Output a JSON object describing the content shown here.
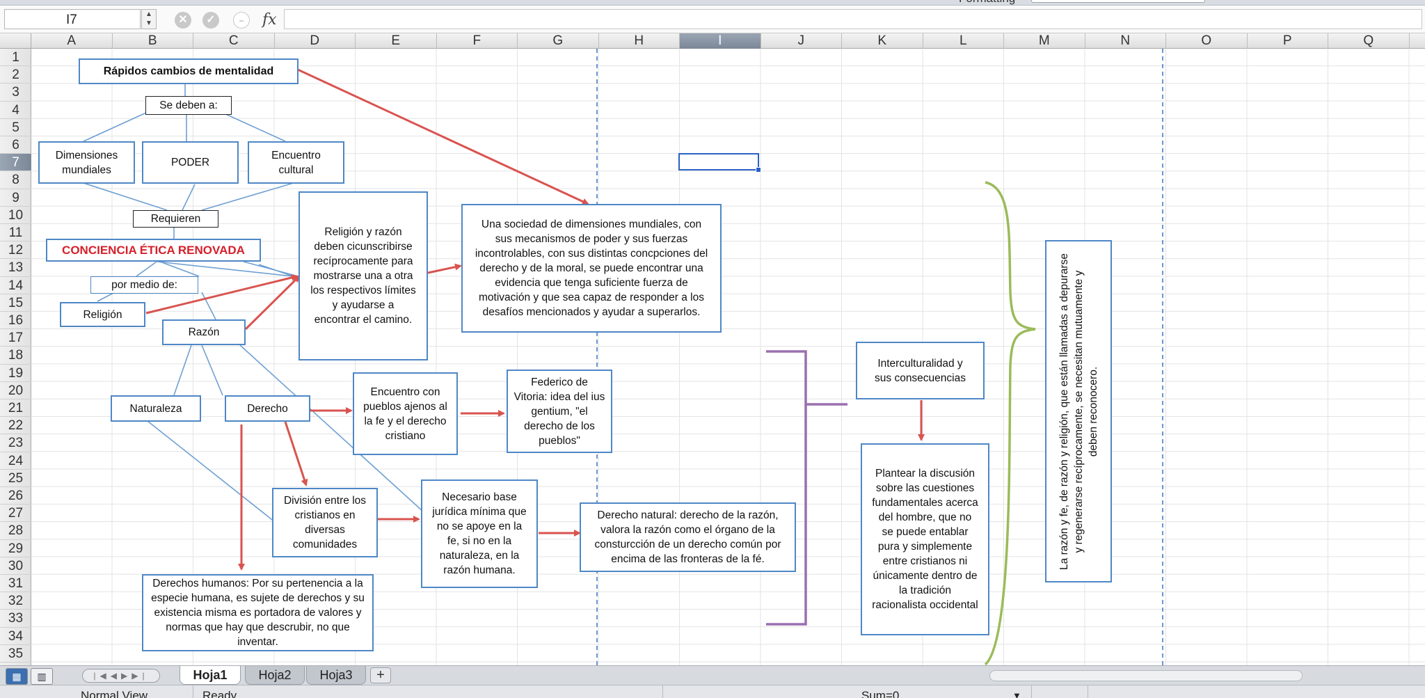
{
  "toolbar": {
    "formatting_label": "Formatting"
  },
  "formula_bar": {
    "name_box": "I7",
    "fx_label": "fx",
    "formula_value": ""
  },
  "columns": [
    "A",
    "B",
    "C",
    "D",
    "E",
    "F",
    "G",
    "H",
    "I",
    "J",
    "K",
    "L",
    "M",
    "N",
    "O",
    "P",
    "Q"
  ],
  "selected_column": "I",
  "rows": [
    "1",
    "2",
    "3",
    "4",
    "5",
    "6",
    "7",
    "8",
    "9",
    "10",
    "11",
    "12",
    "13",
    "14",
    "15",
    "16",
    "17",
    "18",
    "19",
    "20",
    "21",
    "22",
    "23",
    "24",
    "25",
    "26",
    "27",
    "28",
    "29",
    "30",
    "31",
    "32",
    "33",
    "34",
    "35"
  ],
  "selected_row": "7",
  "diagram": {
    "title": "Rápidos cambios de mentalidad",
    "se_deben": "Se deben a:",
    "dimensiones": "Dimensiones mundiales",
    "poder": "PODER",
    "encuentro_cultural": "Encuentro cultural",
    "requieren": "Requieren",
    "conciencia": "CONCIENCIA ÉTICA RENOVADA",
    "por_medio": "por medio de:",
    "religion": "Religión",
    "razon": "Razón",
    "religion_razon": "Religión y razón deben cicunscribirse recíprocamente para mostrarse una a otra los respectivos límites y ayudarse a encontrar el camino.",
    "sociedad": "Una sociedad de dimensiones mundiales, con sus mecanismos de poder y sus fuerzas incontrolables, con sus distintas concpciones del derecho y de la moral, se puede encontrar una evidencia que tenga suficiente fuerza de motivación y que sea capaz de responder a los desafíos mencionados y ayudar a superarlos.",
    "naturaleza": "Naturaleza",
    "derecho": "Derecho",
    "encuentro_pueblos": "Encuentro con pueblos ajenos al la fe y el derecho cristiano",
    "federico": "Federico de Vitoria: idea del ius gentium, \"el derecho de los pueblos\"",
    "division": "División entre los cristianos en diversas comunidades",
    "necesario": "Necesario base jurídica mínima que no se apoye en la fe, si no en la naturaleza, en la razón humana.",
    "derecho_natural": "Derecho natural: derecho de la razón, valora la razón como el órgano de la consturcción de un derecho común por encima de las fronteras de la fé.",
    "derechos_humanos": "Derechos humanos: Por su pertenencia a la especie humana, es sujete de derechos y su existencia misma es portadora de valores y normas que hay que descrubir, no que inventar.",
    "interculturalidad": "Interculturalidad  y sus consecuencias",
    "plantear": "Plantear la discusión sobre las cuestiones fundamentales acerca del hombre, que no se puede entablar pura y simplemente entre cristianos ni únicamente dentro de la tradición racionalista occidental",
    "razon_fe_line1": "La razón y fe, de razón y religión, que están llamadas a depurarse",
    "razon_fe_line2": "y regenerarse recíprocamente, se necesitan mutuamente y",
    "razon_fe_line3": "deben reconocero."
  },
  "sheets": [
    {
      "name": "Hoja1",
      "active": true
    },
    {
      "name": "Hoja2",
      "active": false
    },
    {
      "name": "Hoja3",
      "active": false
    }
  ],
  "status": {
    "view": "Normal View",
    "state": "Ready",
    "sum": "Sum=0"
  },
  "colors": {
    "box_border": "#4e87c6",
    "red_arrow": "#d9534f",
    "purple_brace": "#9a6fb0",
    "green_brace": "#9bbb59",
    "red_text": "#d6202a"
  }
}
